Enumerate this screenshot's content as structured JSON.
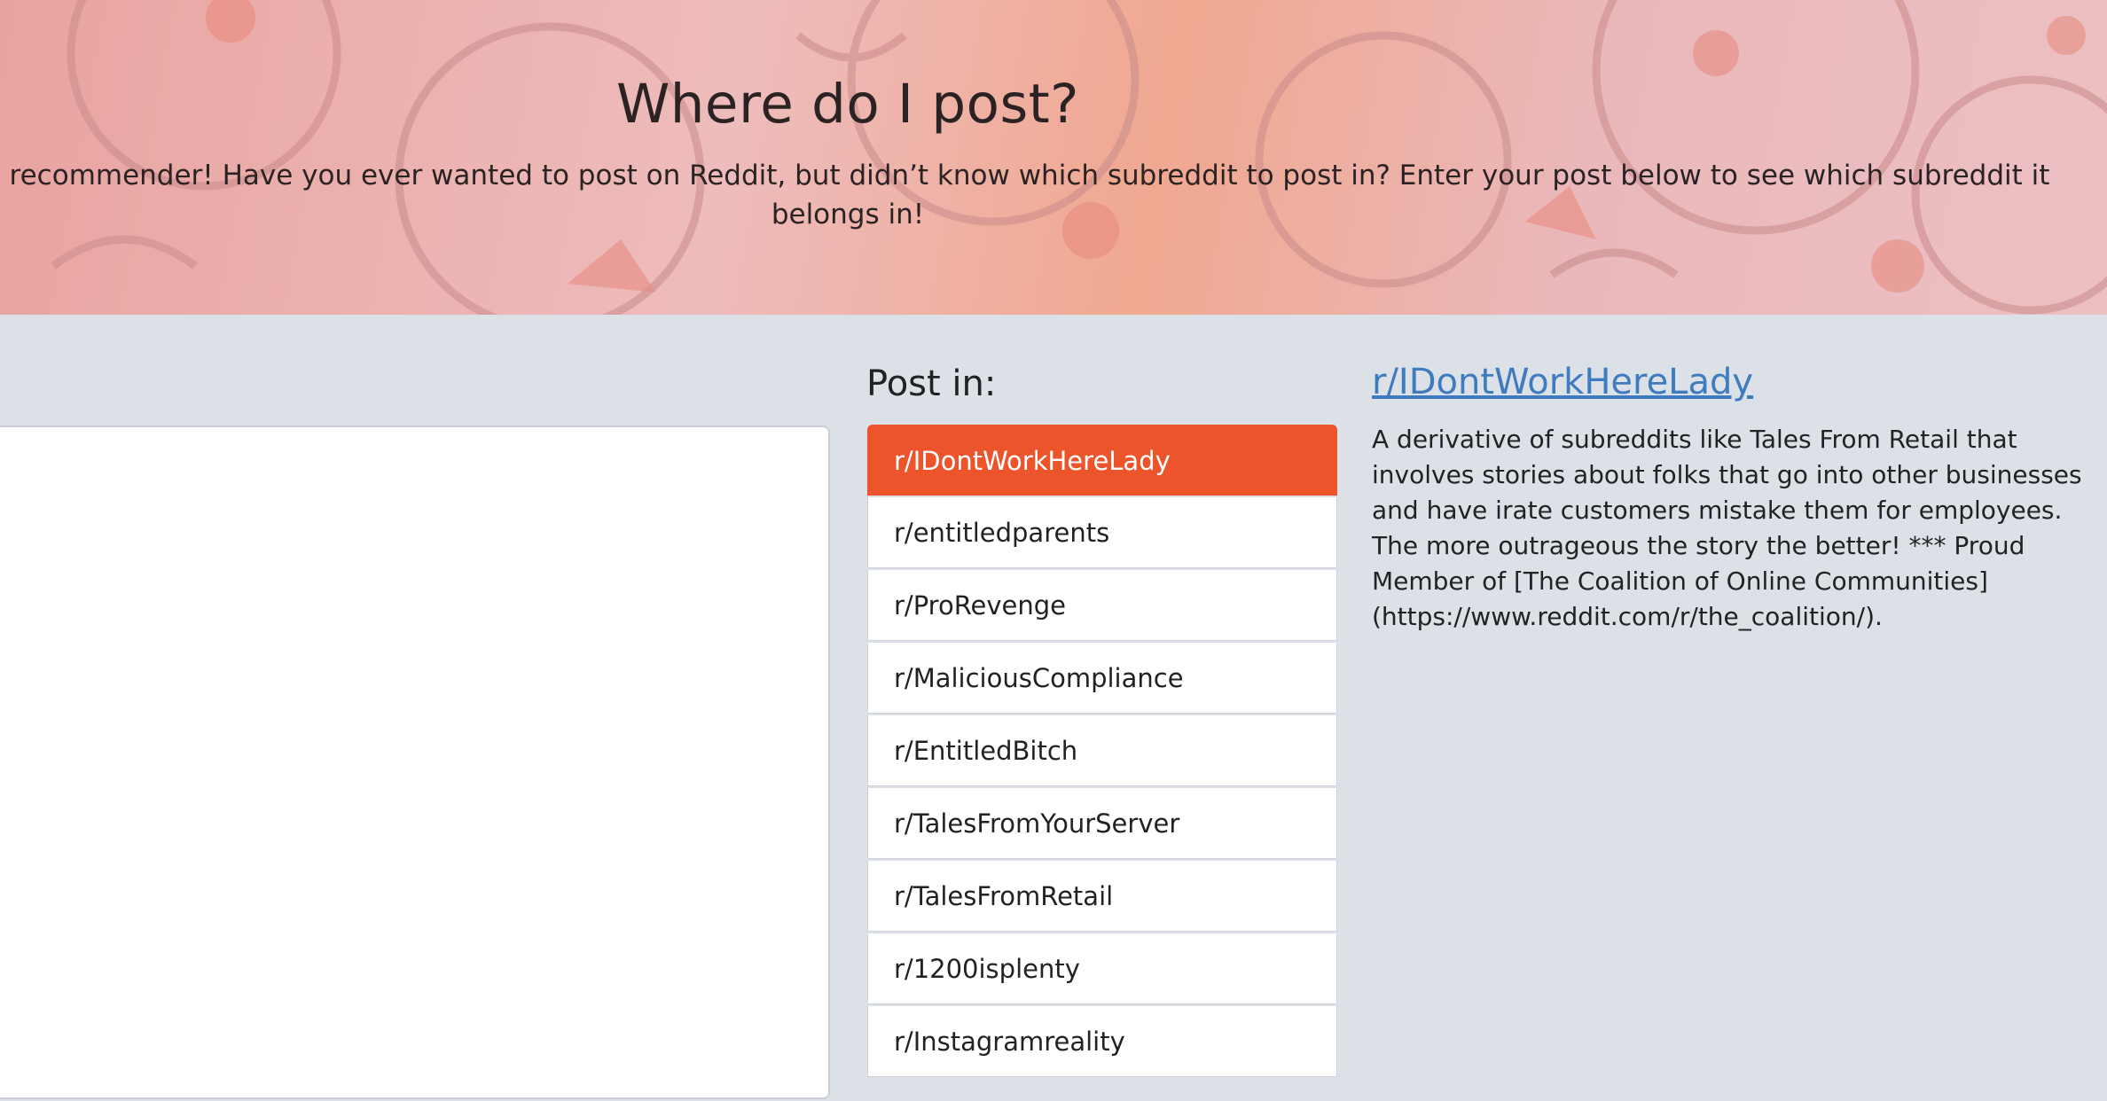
{
  "header": {
    "title": "Where do I post?",
    "subtitle": "Welcome to the subreddit recommender! Have you ever wanted to post on Reddit, but didn’t know which subreddit to post in? Enter your post below to see which subreddit it belongs in!"
  },
  "post_input": {
    "value": "",
    "placeholder": ""
  },
  "results": {
    "label": "Post in:",
    "items": [
      {
        "label": "r/IDontWorkHereLady",
        "selected": true
      },
      {
        "label": "r/entitledparents"
      },
      {
        "label": "r/ProRevenge"
      },
      {
        "label": "r/MaliciousCompliance"
      },
      {
        "label": "r/EntitledBitch"
      },
      {
        "label": "r/TalesFromYourServer"
      },
      {
        "label": "r/TalesFromRetail"
      },
      {
        "label": "r/1200isplenty"
      },
      {
        "label": "r/Instagramreality"
      }
    ]
  },
  "detail": {
    "name": "r/IDontWorkHereLady",
    "description": "A derivative of subreddits like Tales From Retail that involves stories about folks that go into other businesses and have irate customers mistake them for employees. The more outrageous the story the better! *** Proud Member of [The Coalition of Online Communities](https://www.reddit.com/r/the_coalition/)."
  },
  "colors": {
    "accent": "#ec552b",
    "link": "#3e7bbf",
    "background": "#dce0e7",
    "header_pink": "#eab8bb"
  }
}
